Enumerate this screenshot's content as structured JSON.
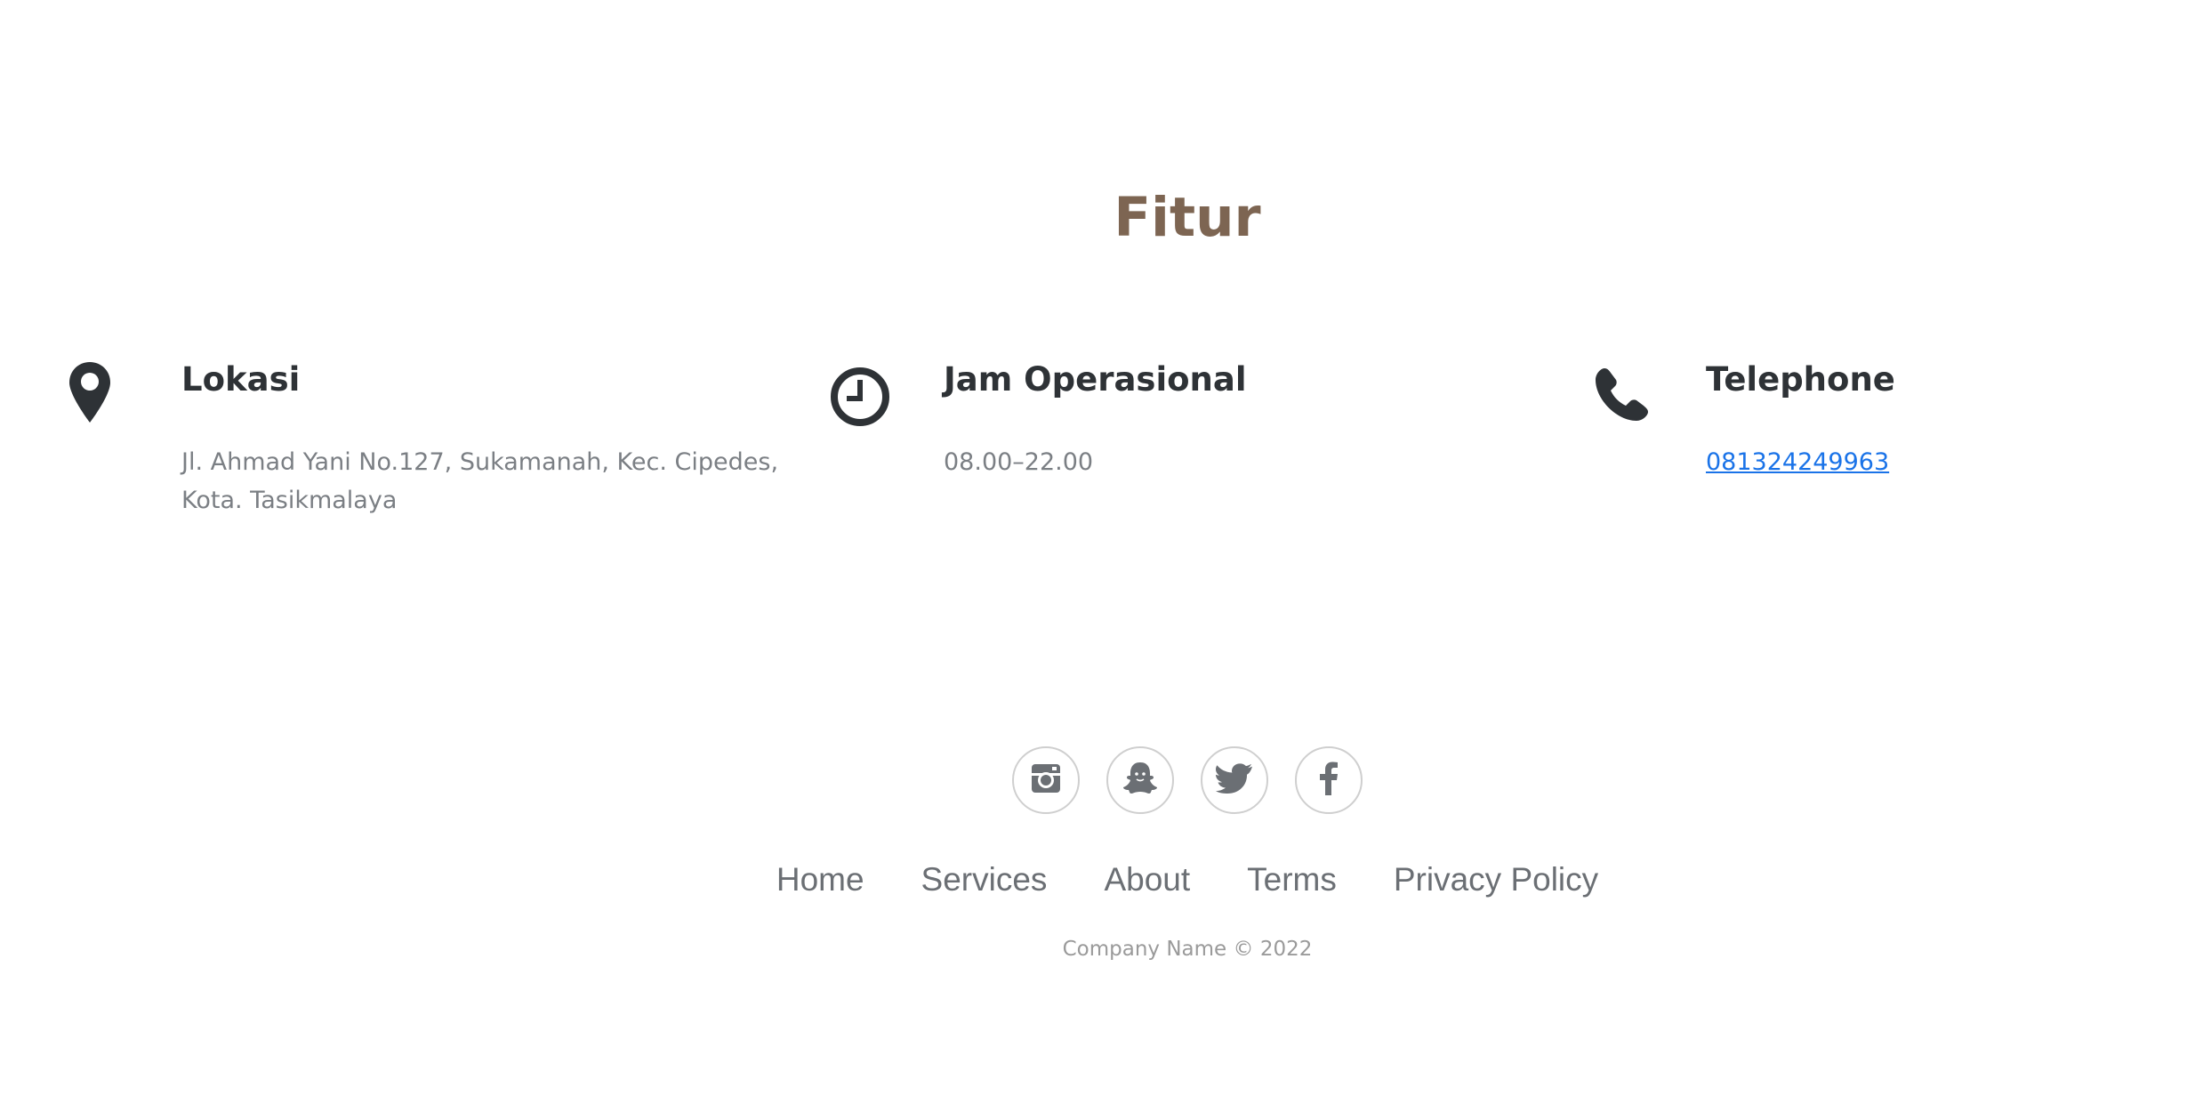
{
  "section": {
    "title": "Fitur"
  },
  "features": [
    {
      "icon": "map-marker-icon",
      "heading": "Lokasi",
      "text": "Jl. Ahmad Yani No.127, Sukamanah, Kec. Cipedes, Kota. Tasikmalaya"
    },
    {
      "icon": "clock-icon",
      "heading": "Jam Operasional",
      "text": "08.00–22.00"
    },
    {
      "icon": "phone-icon",
      "heading": "Telephone",
      "link": "081324249963"
    }
  ],
  "social": [
    "instagram-icon",
    "snapchat-icon",
    "twitter-icon",
    "facebook-icon"
  ],
  "footer": {
    "links": [
      "Home",
      "Services",
      "About",
      "Terms",
      "Privacy Policy"
    ],
    "copyright": "Company Name © 2022"
  },
  "colors": {
    "title": "#7d6552",
    "link": "#1a73e8",
    "icon": "#2e3236",
    "social_icon": "#6b6f74"
  }
}
